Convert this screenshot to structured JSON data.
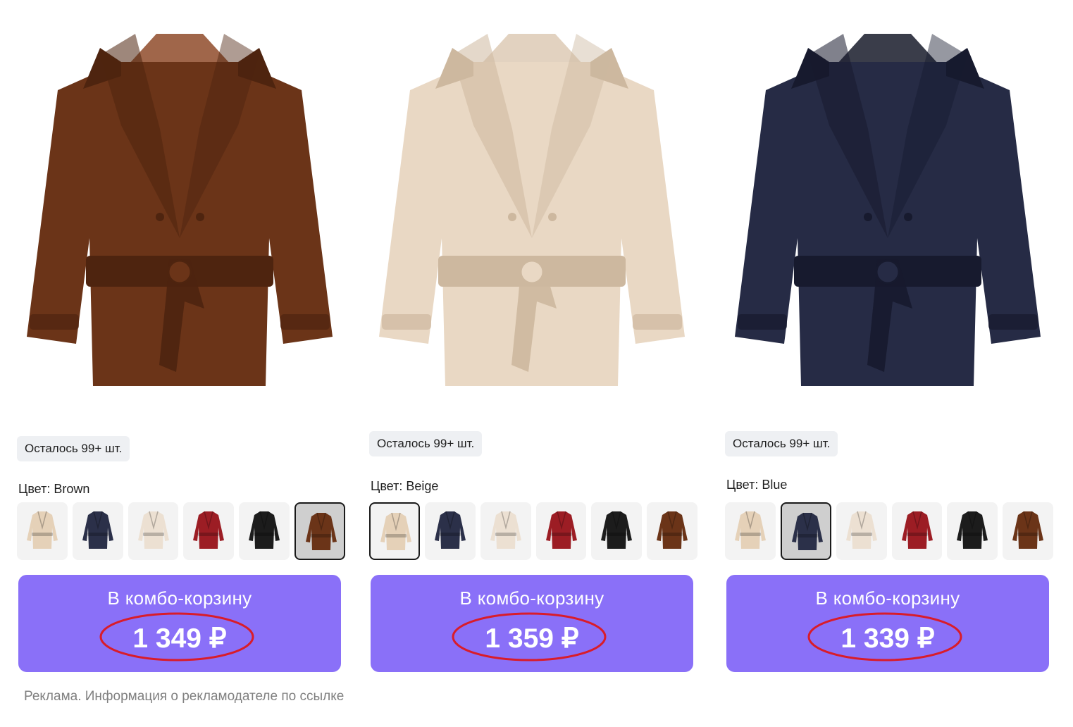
{
  "products": [
    {
      "stock_label": "Осталось 99+ шт.",
      "color_label": "Цвет: Brown",
      "coat_color": "#6b3418",
      "coat_shade": "#4e240f",
      "lining_color": "#a0664a",
      "selected_swatch": 5,
      "button_label": "В комбо-корзину",
      "price": "1 349 ₽"
    },
    {
      "stock_label": "Осталось 99+ шт.",
      "color_label": "Цвет: Beige",
      "coat_color": "#e9d8c4",
      "coat_shade": "#cdb89f",
      "lining_color": "#e2d2c0",
      "selected_swatch": 0,
      "button_label": "В комбо-корзину",
      "price": "1 359 ₽"
    },
    {
      "stock_label": "Осталось 99+ шт.",
      "color_label": "Цвет: Blue",
      "coat_color": "#262b45",
      "coat_shade": "#171a2e",
      "lining_color": "#3a3d4a",
      "selected_swatch": 1,
      "button_label": "В комбо-корзину",
      "price": "1 339 ₽"
    }
  ],
  "swatch_options": [
    {
      "name": "Beige",
      "color": "#e5d1b8"
    },
    {
      "name": "Blue",
      "color": "#2b3049"
    },
    {
      "name": "Light beige",
      "color": "#ece0d2"
    },
    {
      "name": "Red",
      "color": "#9c1d24"
    },
    {
      "name": "Black",
      "color": "#1c1c1c"
    },
    {
      "name": "Brown",
      "color": "#6b3418"
    }
  ],
  "colors": {
    "button_bg": "#8a70f8",
    "highlight_ring": "#d91c2a",
    "stock_badge_bg": "#eef0f3"
  },
  "footer": {
    "ad_notice": "Реклама. Информация о рекламодателе по ссылке"
  }
}
